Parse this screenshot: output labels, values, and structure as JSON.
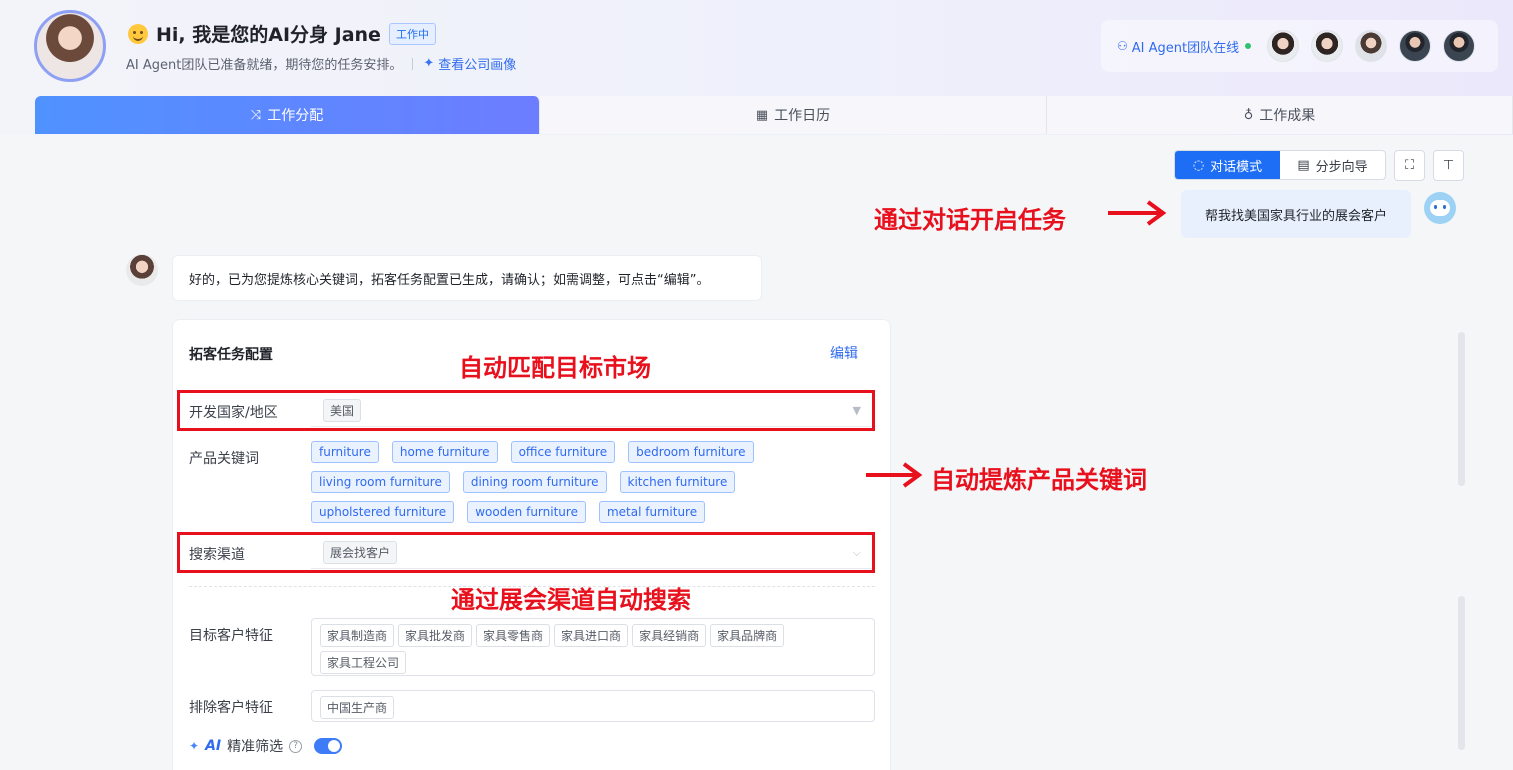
{
  "header": {
    "greeting": "Hi, 我是您的AI分身 Jane",
    "status": "工作中",
    "subtitle": "AI Agent团队已准备就绪，期待您的任务安排。",
    "company_link": "查看公司画像",
    "team_label": "AI Agent团队在线"
  },
  "tabs": [
    {
      "label": "工作分配",
      "icon": "shuffle-icon",
      "active": true
    },
    {
      "label": "工作日历",
      "icon": "calendar-icon",
      "active": false
    },
    {
      "label": "工作成果",
      "icon": "award-icon",
      "active": false
    }
  ],
  "toolbar": {
    "chat_mode": "对话模式",
    "wizard_mode": "分步向导"
  },
  "chat": {
    "user_message": "帮我找美国家具行业的展会客户",
    "assistant_message": "好的，已为您提炼核心关键词，拓客任务配置已生成，请确认；如需调整，可点击“编辑”。"
  },
  "config": {
    "title": "拓客任务配置",
    "edit": "编辑",
    "country_label": "开发国家/地区",
    "country_value": "美国",
    "keywords_label": "产品关键词",
    "keywords": [
      "furniture",
      "home furniture",
      "office furniture",
      "bedroom furniture",
      "living room furniture",
      "dining room furniture",
      "kitchen furniture",
      "upholstered furniture",
      "wooden furniture",
      "metal furniture"
    ],
    "channel_label": "搜索渠道",
    "channel_value": "展会找客户",
    "target_label": "目标客户特征",
    "target_tags": [
      "家具制造商",
      "家具批发商",
      "家具零售商",
      "家具进口商",
      "家具经销商",
      "家具品牌商",
      "家具工程公司"
    ],
    "exclude_label": "排除客户特征",
    "exclude_tags": [
      "中国生产商"
    ],
    "ai_label": "AI",
    "ai_filter": "精准筛选",
    "ai_filter_on": true
  },
  "annotations": {
    "start_task": "通过对话开启任务",
    "match_market": "自动匹配目标市场",
    "extract_keywords": "自动提炼产品关键词",
    "search_channel": "通过展会渠道自动搜索"
  },
  "colors": {
    "accent": "#1d6ef5",
    "annotation": "#e8101c",
    "tab_gradient_start": "#4f92ff",
    "tab_gradient_end": "#6c7dff"
  }
}
